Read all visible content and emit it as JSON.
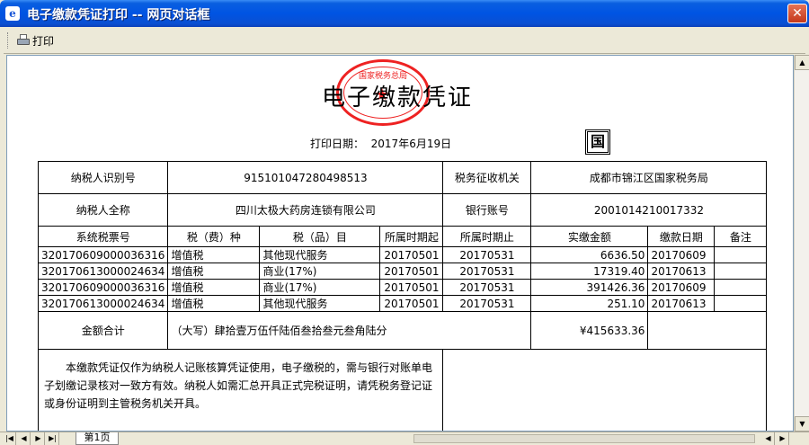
{
  "window": {
    "title": "电子缴款凭证打印 -- 网页对话框",
    "icon_glyph": "e",
    "close_glyph": "✕"
  },
  "toolbar": {
    "print_label": "打印"
  },
  "document": {
    "title": "电子缴款凭证",
    "print_date_label": "打印日期：",
    "print_date": "2017年6月19日",
    "guo_char": "国",
    "stamp_text": "国家税务总局",
    "info": {
      "taxpayer_id_label": "纳税人识别号",
      "taxpayer_id": "915101047280498513",
      "tax_office_label": "税务征收机关",
      "tax_office": "成都市锦江区国家税务局",
      "taxpayer_name_label": "纳税人全称",
      "taxpayer_name": "四川太极大药房连锁有限公司",
      "bank_account_label": "银行账号",
      "bank_account": "2001014210017332"
    },
    "columns": [
      "系统税票号",
      "税（费）种",
      "税（品）目",
      "所属时期起",
      "所属时期止",
      "实缴金额",
      "缴款日期",
      "备注"
    ],
    "rows": [
      {
        "ticket": "320170609000036316",
        "tax_type": "增值税",
        "item": "其他现代服务",
        "from": "20170501",
        "to": "20170531",
        "amount": "6636.50",
        "date": "20170609",
        "note": ""
      },
      {
        "ticket": "320170613000024634",
        "tax_type": "增值税",
        "item": "商业(17%)",
        "from": "20170501",
        "to": "20170531",
        "amount": "17319.40",
        "date": "20170613",
        "note": ""
      },
      {
        "ticket": "320170609000036316",
        "tax_type": "增值税",
        "item": "商业(17%)",
        "from": "20170501",
        "to": "20170531",
        "amount": "391426.36",
        "date": "20170609",
        "note": ""
      },
      {
        "ticket": "320170613000024634",
        "tax_type": "增值税",
        "item": "其他现代服务",
        "from": "20170501",
        "to": "20170531",
        "amount": "251.10",
        "date": "20170613",
        "note": ""
      }
    ],
    "total_label": "金额合计",
    "total_words": "（大写）肆拾壹万伍仟陆佰叁拾叁元叁角陆分",
    "total_amount": "¥415633.36",
    "notice": "本缴款凭证仅作为纳税人记账核算凭证使用，电子缴税的，需与银行对账单电子划缴记录核对一致方有效。纳税人如需汇总开具正式完税证明，请凭税务登记证或身份证明到主管税务机关开具。"
  },
  "statusbar": {
    "page_tab": "第1页"
  }
}
